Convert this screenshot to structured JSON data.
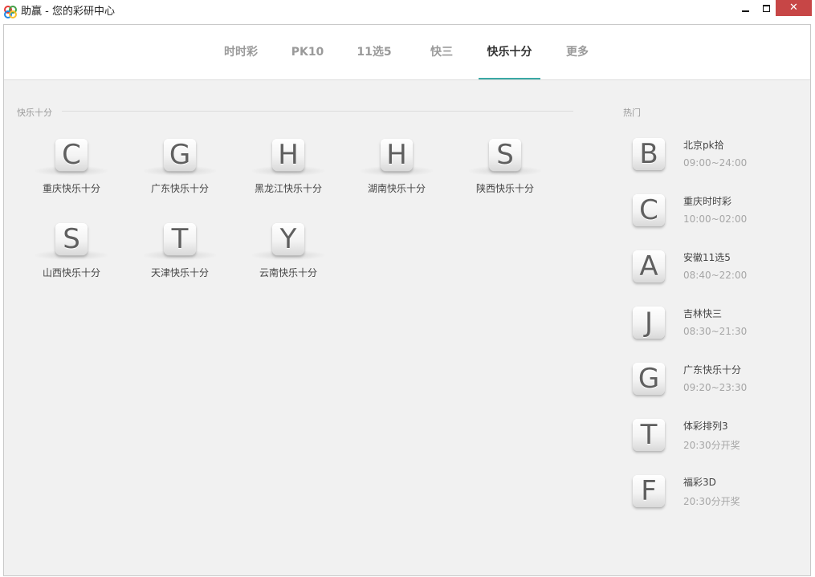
{
  "window": {
    "title": "助赢 - 您的彩研中心",
    "close_glyph": "✕"
  },
  "nav": {
    "tabs": [
      {
        "label": "时时彩"
      },
      {
        "label": "PK10"
      },
      {
        "label": "11选5"
      },
      {
        "label": "快三"
      },
      {
        "label": "快乐十分"
      },
      {
        "label": "更多"
      }
    ],
    "active_tab": "快乐十分"
  },
  "main": {
    "section_title": "快乐十分",
    "items": [
      {
        "letter": "C",
        "label": "重庆快乐十分"
      },
      {
        "letter": "G",
        "label": "广东快乐十分"
      },
      {
        "letter": "H",
        "label": "黑龙江快乐十分"
      },
      {
        "letter": "H",
        "label": "湖南快乐十分"
      },
      {
        "letter": "S",
        "label": "陕西快乐十分"
      },
      {
        "letter": "S",
        "label": "山西快乐十分"
      },
      {
        "letter": "T",
        "label": "天津快乐十分"
      },
      {
        "letter": "Y",
        "label": "云南快乐十分"
      }
    ]
  },
  "hot": {
    "section_title": "热门",
    "items": [
      {
        "letter": "B",
        "name": "北京pk拾",
        "time": "09:00~24:00"
      },
      {
        "letter": "C",
        "name": "重庆时时彩",
        "time": "10:00~02:00"
      },
      {
        "letter": "A",
        "name": "安徽11选5",
        "time": "08:40~22:00"
      },
      {
        "letter": "J",
        "name": "吉林快三",
        "time": "08:30~21:30"
      },
      {
        "letter": "G",
        "name": "广东快乐十分",
        "time": "09:20~23:30"
      },
      {
        "letter": "T",
        "name": "体彩排列3",
        "time": "20:30分开奖"
      },
      {
        "letter": "F",
        "name": "福彩3D",
        "time": "20:30分开奖"
      }
    ]
  },
  "colors": {
    "accent": "#3aa8a5",
    "close_button": "#c74646",
    "background": "#f1f1f1"
  }
}
